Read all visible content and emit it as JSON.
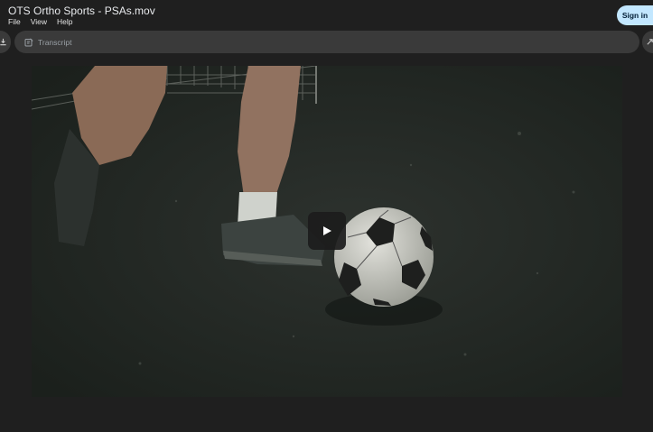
{
  "window": {
    "title": "OTS Ortho Sports - PSAs.mov",
    "sign_in_label": "Sign in"
  },
  "menu": {
    "items": [
      "File",
      "View",
      "Help"
    ]
  },
  "toolbar": {
    "transcript_label": "Transcript",
    "left_icon": "download-icon",
    "right_icon": "expand-icon"
  },
  "video": {
    "state": "paused",
    "play_icon": "play-icon"
  },
  "colors": {
    "background": "#1f1f1f",
    "toolbar": "#3a3a3a",
    "sign_in_bg": "#c2e7ff"
  }
}
